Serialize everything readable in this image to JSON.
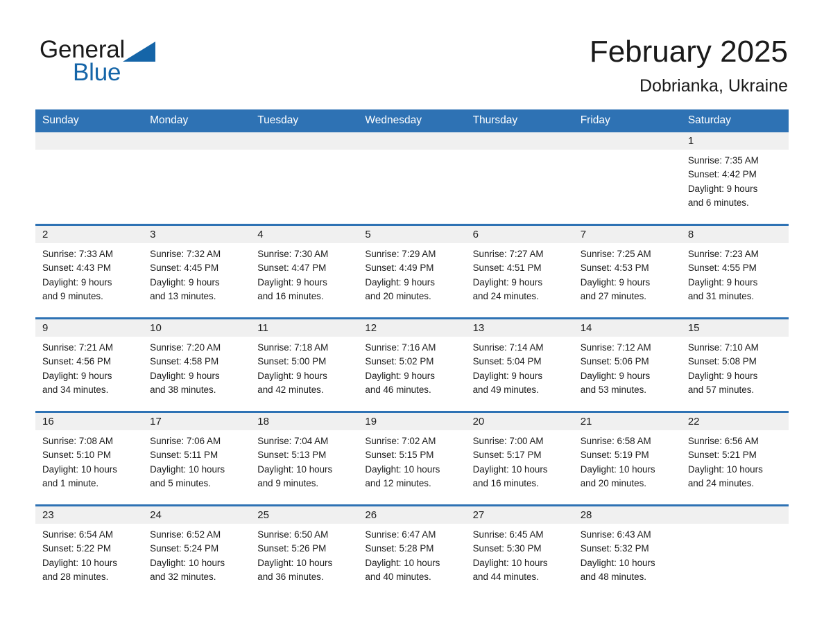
{
  "brand": {
    "name_top": "General",
    "name_bottom": "Blue",
    "triangle_icon": "triangle-icon",
    "color_black": "#1a1a1a",
    "color_blue": "#1565a8"
  },
  "header": {
    "title": "February 2025",
    "subtitle": "Dobrianka, Ukraine"
  },
  "theme": {
    "header_blue": "#2e72b4",
    "daynum_band_gray": "#f0f0f0",
    "cell_white": "#ffffff",
    "text_black": "#1a1a1a"
  },
  "weekday_headers": [
    "Sunday",
    "Monday",
    "Tuesday",
    "Wednesday",
    "Thursday",
    "Friday",
    "Saturday"
  ],
  "labels": {
    "sunrise_prefix": "Sunrise:",
    "sunset_prefix": "Sunset:",
    "daylight_prefix": "Daylight:"
  },
  "weeks": [
    {
      "days": [
        {
          "empty": true
        },
        {
          "empty": true
        },
        {
          "empty": true
        },
        {
          "empty": true
        },
        {
          "empty": true
        },
        {
          "empty": true
        },
        {
          "empty": false,
          "daynum": "1",
          "sunrise": "Sunrise: 7:35 AM",
          "sunset": "Sunset: 4:42 PM",
          "daylight_line1": "Daylight: 9 hours",
          "daylight_line2": "and 6 minutes."
        }
      ]
    },
    {
      "days": [
        {
          "empty": false,
          "daynum": "2",
          "sunrise": "Sunrise: 7:33 AM",
          "sunset": "Sunset: 4:43 PM",
          "daylight_line1": "Daylight: 9 hours",
          "daylight_line2": "and 9 minutes."
        },
        {
          "empty": false,
          "daynum": "3",
          "sunrise": "Sunrise: 7:32 AM",
          "sunset": "Sunset: 4:45 PM",
          "daylight_line1": "Daylight: 9 hours",
          "daylight_line2": "and 13 minutes."
        },
        {
          "empty": false,
          "daynum": "4",
          "sunrise": "Sunrise: 7:30 AM",
          "sunset": "Sunset: 4:47 PM",
          "daylight_line1": "Daylight: 9 hours",
          "daylight_line2": "and 16 minutes."
        },
        {
          "empty": false,
          "daynum": "5",
          "sunrise": "Sunrise: 7:29 AM",
          "sunset": "Sunset: 4:49 PM",
          "daylight_line1": "Daylight: 9 hours",
          "daylight_line2": "and 20 minutes."
        },
        {
          "empty": false,
          "daynum": "6",
          "sunrise": "Sunrise: 7:27 AM",
          "sunset": "Sunset: 4:51 PM",
          "daylight_line1": "Daylight: 9 hours",
          "daylight_line2": "and 24 minutes."
        },
        {
          "empty": false,
          "daynum": "7",
          "sunrise": "Sunrise: 7:25 AM",
          "sunset": "Sunset: 4:53 PM",
          "daylight_line1": "Daylight: 9 hours",
          "daylight_line2": "and 27 minutes."
        },
        {
          "empty": false,
          "daynum": "8",
          "sunrise": "Sunrise: 7:23 AM",
          "sunset": "Sunset: 4:55 PM",
          "daylight_line1": "Daylight: 9 hours",
          "daylight_line2": "and 31 minutes."
        }
      ]
    },
    {
      "days": [
        {
          "empty": false,
          "daynum": "9",
          "sunrise": "Sunrise: 7:21 AM",
          "sunset": "Sunset: 4:56 PM",
          "daylight_line1": "Daylight: 9 hours",
          "daylight_line2": "and 34 minutes."
        },
        {
          "empty": false,
          "daynum": "10",
          "sunrise": "Sunrise: 7:20 AM",
          "sunset": "Sunset: 4:58 PM",
          "daylight_line1": "Daylight: 9 hours",
          "daylight_line2": "and 38 minutes."
        },
        {
          "empty": false,
          "daynum": "11",
          "sunrise": "Sunrise: 7:18 AM",
          "sunset": "Sunset: 5:00 PM",
          "daylight_line1": "Daylight: 9 hours",
          "daylight_line2": "and 42 minutes."
        },
        {
          "empty": false,
          "daynum": "12",
          "sunrise": "Sunrise: 7:16 AM",
          "sunset": "Sunset: 5:02 PM",
          "daylight_line1": "Daylight: 9 hours",
          "daylight_line2": "and 46 minutes."
        },
        {
          "empty": false,
          "daynum": "13",
          "sunrise": "Sunrise: 7:14 AM",
          "sunset": "Sunset: 5:04 PM",
          "daylight_line1": "Daylight: 9 hours",
          "daylight_line2": "and 49 minutes."
        },
        {
          "empty": false,
          "daynum": "14",
          "sunrise": "Sunrise: 7:12 AM",
          "sunset": "Sunset: 5:06 PM",
          "daylight_line1": "Daylight: 9 hours",
          "daylight_line2": "and 53 minutes."
        },
        {
          "empty": false,
          "daynum": "15",
          "sunrise": "Sunrise: 7:10 AM",
          "sunset": "Sunset: 5:08 PM",
          "daylight_line1": "Daylight: 9 hours",
          "daylight_line2": "and 57 minutes."
        }
      ]
    },
    {
      "days": [
        {
          "empty": false,
          "daynum": "16",
          "sunrise": "Sunrise: 7:08 AM",
          "sunset": "Sunset: 5:10 PM",
          "daylight_line1": "Daylight: 10 hours",
          "daylight_line2": "and 1 minute."
        },
        {
          "empty": false,
          "daynum": "17",
          "sunrise": "Sunrise: 7:06 AM",
          "sunset": "Sunset: 5:11 PM",
          "daylight_line1": "Daylight: 10 hours",
          "daylight_line2": "and 5 minutes."
        },
        {
          "empty": false,
          "daynum": "18",
          "sunrise": "Sunrise: 7:04 AM",
          "sunset": "Sunset: 5:13 PM",
          "daylight_line1": "Daylight: 10 hours",
          "daylight_line2": "and 9 minutes."
        },
        {
          "empty": false,
          "daynum": "19",
          "sunrise": "Sunrise: 7:02 AM",
          "sunset": "Sunset: 5:15 PM",
          "daylight_line1": "Daylight: 10 hours",
          "daylight_line2": "and 12 minutes."
        },
        {
          "empty": false,
          "daynum": "20",
          "sunrise": "Sunrise: 7:00 AM",
          "sunset": "Sunset: 5:17 PM",
          "daylight_line1": "Daylight: 10 hours",
          "daylight_line2": "and 16 minutes."
        },
        {
          "empty": false,
          "daynum": "21",
          "sunrise": "Sunrise: 6:58 AM",
          "sunset": "Sunset: 5:19 PM",
          "daylight_line1": "Daylight: 10 hours",
          "daylight_line2": "and 20 minutes."
        },
        {
          "empty": false,
          "daynum": "22",
          "sunrise": "Sunrise: 6:56 AM",
          "sunset": "Sunset: 5:21 PM",
          "daylight_line1": "Daylight: 10 hours",
          "daylight_line2": "and 24 minutes."
        }
      ]
    },
    {
      "days": [
        {
          "empty": false,
          "daynum": "23",
          "sunrise": "Sunrise: 6:54 AM",
          "sunset": "Sunset: 5:22 PM",
          "daylight_line1": "Daylight: 10 hours",
          "daylight_line2": "and 28 minutes."
        },
        {
          "empty": false,
          "daynum": "24",
          "sunrise": "Sunrise: 6:52 AM",
          "sunset": "Sunset: 5:24 PM",
          "daylight_line1": "Daylight: 10 hours",
          "daylight_line2": "and 32 minutes."
        },
        {
          "empty": false,
          "daynum": "25",
          "sunrise": "Sunrise: 6:50 AM",
          "sunset": "Sunset: 5:26 PM",
          "daylight_line1": "Daylight: 10 hours",
          "daylight_line2": "and 36 minutes."
        },
        {
          "empty": false,
          "daynum": "26",
          "sunrise": "Sunrise: 6:47 AM",
          "sunset": "Sunset: 5:28 PM",
          "daylight_line1": "Daylight: 10 hours",
          "daylight_line2": "and 40 minutes."
        },
        {
          "empty": false,
          "daynum": "27",
          "sunrise": "Sunrise: 6:45 AM",
          "sunset": "Sunset: 5:30 PM",
          "daylight_line1": "Daylight: 10 hours",
          "daylight_line2": "and 44 minutes."
        },
        {
          "empty": false,
          "daynum": "28",
          "sunrise": "Sunrise: 6:43 AM",
          "sunset": "Sunset: 5:32 PM",
          "daylight_line1": "Daylight: 10 hours",
          "daylight_line2": "and 48 minutes."
        },
        {
          "empty": true
        }
      ]
    }
  ]
}
